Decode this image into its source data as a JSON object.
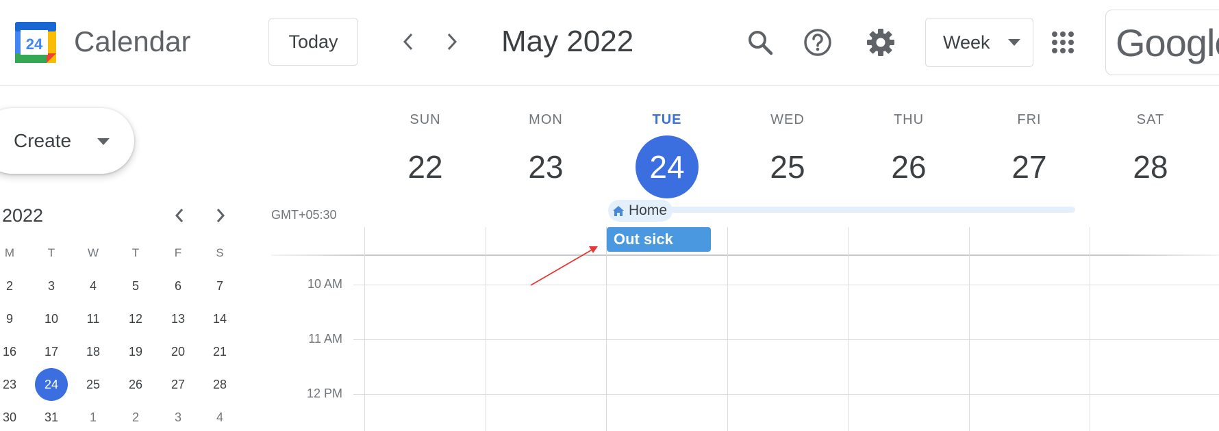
{
  "header": {
    "app_title": "Calendar",
    "logo_day": "24",
    "today_label": "Today",
    "month_label": "May 2022",
    "view_label": "Week",
    "account_brand": "Google"
  },
  "sidebar": {
    "create_label": "Create",
    "mini_calendar": {
      "title": "2022",
      "weekday_heads": [
        "M",
        "T",
        "W",
        "T",
        "F",
        "S"
      ],
      "weeks": [
        [
          "2",
          "3",
          "4",
          "5",
          "6",
          "7"
        ],
        [
          "9",
          "10",
          "11",
          "12",
          "13",
          "14"
        ],
        [
          "16",
          "17",
          "18",
          "19",
          "20",
          "21"
        ],
        [
          "23",
          "24",
          "25",
          "26",
          "27",
          "28"
        ],
        [
          "30",
          "31",
          "1",
          "2",
          "3",
          "4"
        ]
      ],
      "selected_day": "24"
    }
  },
  "week": {
    "timezone": "GMT+05:30",
    "days": [
      {
        "name": "SUN",
        "num": "22"
      },
      {
        "name": "MON",
        "num": "23"
      },
      {
        "name": "TUE",
        "num": "24"
      },
      {
        "name": "WED",
        "num": "25"
      },
      {
        "name": "THU",
        "num": "26"
      },
      {
        "name": "FRI",
        "num": "27"
      },
      {
        "name": "SAT",
        "num": "28"
      }
    ],
    "today_index": 2,
    "working_location": "Home",
    "time_labels": [
      "10 AM",
      "11 AM",
      "12 PM"
    ],
    "events": [
      {
        "title": "Out sick",
        "day": "TUE",
        "color": "#4a99e0"
      }
    ]
  },
  "colors": {
    "accent": "#3b6fe0",
    "event": "#4a99e0",
    "working_location_bg": "#e3f0fb",
    "annotation_arrow": "#e53935"
  },
  "icons": {
    "nav_prev": "chevron-left-icon",
    "nav_next": "chevron-right-icon",
    "search": "search-icon",
    "help": "help-icon",
    "settings": "gear-icon",
    "apps": "apps-grid-icon",
    "home": "home-icon"
  }
}
